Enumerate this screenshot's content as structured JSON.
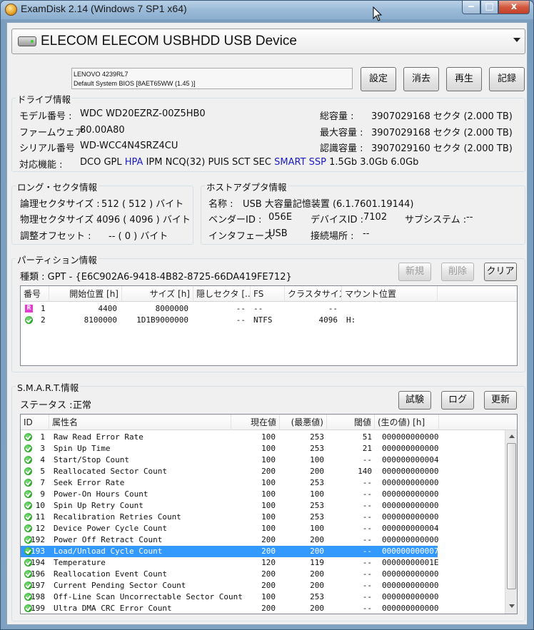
{
  "window": {
    "title": "ExamDisk 2.14 (Windows 7 SP1 x64)",
    "min_label": "‒",
    "max_label": "□",
    "close_label": "x"
  },
  "device": {
    "name": "ELECOM ELECOM USBHDD USB Device"
  },
  "bios": {
    "line1": "LENOVO 4239RL7",
    "line2": "Default System BIOS [8AET65WW (1.45 )]"
  },
  "buttons": {
    "settings": "設定",
    "clear": "消去",
    "play": "再生",
    "record": "記録"
  },
  "drive_info": {
    "title": "ドライブ情報",
    "model_label": "モデル番号 :",
    "model": "WDC WD20EZRZ-00Z5HB0",
    "firmware_label": "ファームウェア",
    "firmware": "80.00A80",
    "serial_label": "シリアル番号",
    "serial": "WD-WCC4N4SRZ4CU",
    "features_label": "対応機能 :",
    "features_a": "DCO GPL",
    "features_hpa": "HPA",
    "features_b": "IPM NCQ(32) PUIS SCT SEC",
    "features_smart": "SMART SSP",
    "features_c": "1.5Gb 3.0Gb 6.0Gb",
    "total_label": "総容量 :",
    "total": "3907029168 セクタ (2.000 TB)",
    "max_label": "最大容量 :",
    "max": "3907029168 セクタ (2.000 TB)",
    "recognized_label": "認識容量 :",
    "recognized": "3907029160 セクタ (2.000 TB)"
  },
  "long_sector": {
    "title": "ロング・セクタ情報",
    "logical_label": "論理セクタサイズ :",
    "logical": "512 (  512 ) バイト",
    "physical_label": "物理セクタサイズ :",
    "physical": "4096 ( 4096 ) バイト",
    "offset_label": "調整オフセット :",
    "offset": "-- (    0 ) バイト"
  },
  "host_adapter": {
    "title": "ホストアダプタ情報",
    "name_label": "名称 :",
    "name": "USB 大容量記憶装置 (6.1.7601.19144)",
    "vendor_label": "ベンダーID :",
    "vendor": "056E",
    "device_label": "デバイスID :",
    "device": "7102",
    "subsystem_label": "サブシステム :",
    "subsystem": "--",
    "interface_label": "インタフェース",
    "interface": "USB",
    "connection_label": "接続場所 :",
    "connection": "--"
  },
  "partition": {
    "title": "パーティション情報",
    "type_line": "種類 : GPT - {E6C902A6-9418-4B82-8725-66DA419FE712}",
    "new_btn": "新規",
    "delete_btn": "削除",
    "clear_btn": "クリア",
    "columns": [
      "番号",
      "開始位置 [h]",
      "サイズ [h]",
      "隠しセクタ [...",
      "FS",
      "クラスタサイズ",
      "マウント位置"
    ],
    "rows": [
      {
        "icon": "R",
        "no": "1",
        "start": "4400",
        "size": "8000000",
        "hidden": "--",
        "fs": "--",
        "cluster": "--",
        "mount": ""
      },
      {
        "icon": "ok",
        "no": "2",
        "start": "8100000",
        "size": "1D1B9000000",
        "hidden": "--",
        "fs": "NTFS",
        "cluster": "4096",
        "mount": "H:"
      }
    ]
  },
  "smart": {
    "title": "S.M.A.R.T.情報",
    "status_label": "ステータス :",
    "status": "正常",
    "test_btn": "試験",
    "log_btn": "ログ",
    "refresh_btn": "更新",
    "columns": [
      "ID",
      "属性名",
      "現在値",
      "(最悪値)",
      "閾値",
      "(生の値) [h]"
    ],
    "rows": [
      {
        "id": "1",
        "name": "Raw Read Error Rate",
        "cur": "100",
        "worst": "253",
        "thr": "51",
        "raw": "000000000000"
      },
      {
        "id": "3",
        "name": "Spin Up Time",
        "cur": "100",
        "worst": "253",
        "thr": "21",
        "raw": "000000000000"
      },
      {
        "id": "4",
        "name": "Start/Stop Count",
        "cur": "100",
        "worst": "100",
        "thr": "--",
        "raw": "000000000004"
      },
      {
        "id": "5",
        "name": "Reallocated Sector Count",
        "cur": "200",
        "worst": "200",
        "thr": "140",
        "raw": "000000000000"
      },
      {
        "id": "7",
        "name": "Seek Error Rate",
        "cur": "100",
        "worst": "253",
        "thr": "--",
        "raw": "000000000000"
      },
      {
        "id": "9",
        "name": "Power-On Hours Count",
        "cur": "100",
        "worst": "100",
        "thr": "--",
        "raw": "000000000000"
      },
      {
        "id": "10",
        "name": "Spin Up Retry Count",
        "cur": "100",
        "worst": "253",
        "thr": "--",
        "raw": "000000000000"
      },
      {
        "id": "11",
        "name": "Recalibration Retries Count",
        "cur": "100",
        "worst": "253",
        "thr": "--",
        "raw": "000000000000"
      },
      {
        "id": "12",
        "name": "Device Power Cycle Count",
        "cur": "100",
        "worst": "100",
        "thr": "--",
        "raw": "000000000004"
      },
      {
        "id": "192",
        "name": "Power Off Retract Count",
        "cur": "200",
        "worst": "200",
        "thr": "--",
        "raw": "000000000000"
      },
      {
        "id": "193",
        "name": "Load/Unload Cycle Count",
        "cur": "200",
        "worst": "200",
        "thr": "--",
        "raw": "000000000007",
        "selected": true
      },
      {
        "id": "194",
        "name": "Temperature",
        "cur": "120",
        "worst": "119",
        "thr": "--",
        "raw": "00000000001E"
      },
      {
        "id": "196",
        "name": "Reallocation Event Count",
        "cur": "200",
        "worst": "200",
        "thr": "--",
        "raw": "000000000000"
      },
      {
        "id": "197",
        "name": "Current Pending Sector Count",
        "cur": "200",
        "worst": "200",
        "thr": "--",
        "raw": "000000000000"
      },
      {
        "id": "198",
        "name": "Off-Line Scan Uncorrectable Sector Count",
        "cur": "100",
        "worst": "253",
        "thr": "--",
        "raw": "000000000000"
      },
      {
        "id": "199",
        "name": "Ultra DMA CRC Error Count",
        "cur": "200",
        "worst": "200",
        "thr": "--",
        "raw": "000000000000"
      }
    ]
  },
  "colors": {
    "accent_blue": "#1c1cc4",
    "selection": "#3399ff",
    "ok_green": "#1fa21f",
    "reserved_magenta": "#e23fd1"
  },
  "icons": [
    "app-icon",
    "hdd-icon",
    "dropdown-arrow-icon",
    "ok-icon",
    "reserved-partition-icon"
  ]
}
